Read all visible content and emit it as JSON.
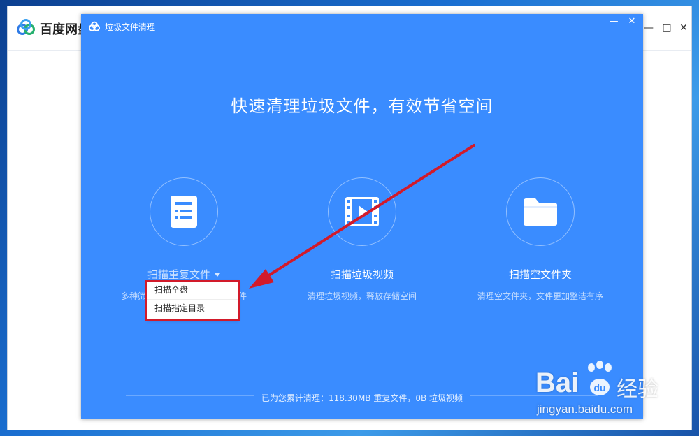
{
  "main_window": {
    "title": "百度网盘",
    "minimize_symbol": "—",
    "maximize_symbol": "□",
    "close_symbol": "✕"
  },
  "dialog": {
    "title": "垃圾文件清理",
    "minimize_symbol": "—",
    "close_symbol": "✕",
    "headline": "快速清理垃圾文件，有效节省空间",
    "features": [
      {
        "label": "扫描重复文件",
        "desc": "多种筛选方式，快速查找重复文件",
        "icon": "document-list-icon"
      },
      {
        "label": "扫描垃圾视频",
        "desc": "清理垃圾视频，释放存储空间",
        "icon": "video-film-icon"
      },
      {
        "label": "扫描空文件夹",
        "desc": "清理空文件夹，文件更加整洁有序",
        "icon": "folder-icon"
      }
    ],
    "dropdown": [
      "扫描全盘",
      "扫描指定目录"
    ],
    "footer": "已为您累计清理：118.30MB 重复文件，0B 垃圾视频"
  },
  "watermark": {
    "brand": "Bai",
    "brand_suffix": "经验",
    "url": "jingyan.baidu.com"
  },
  "colors": {
    "dialog_bg": "#3a8cff",
    "highlight": "#d21a2a",
    "arrow": "#d21a2a"
  }
}
